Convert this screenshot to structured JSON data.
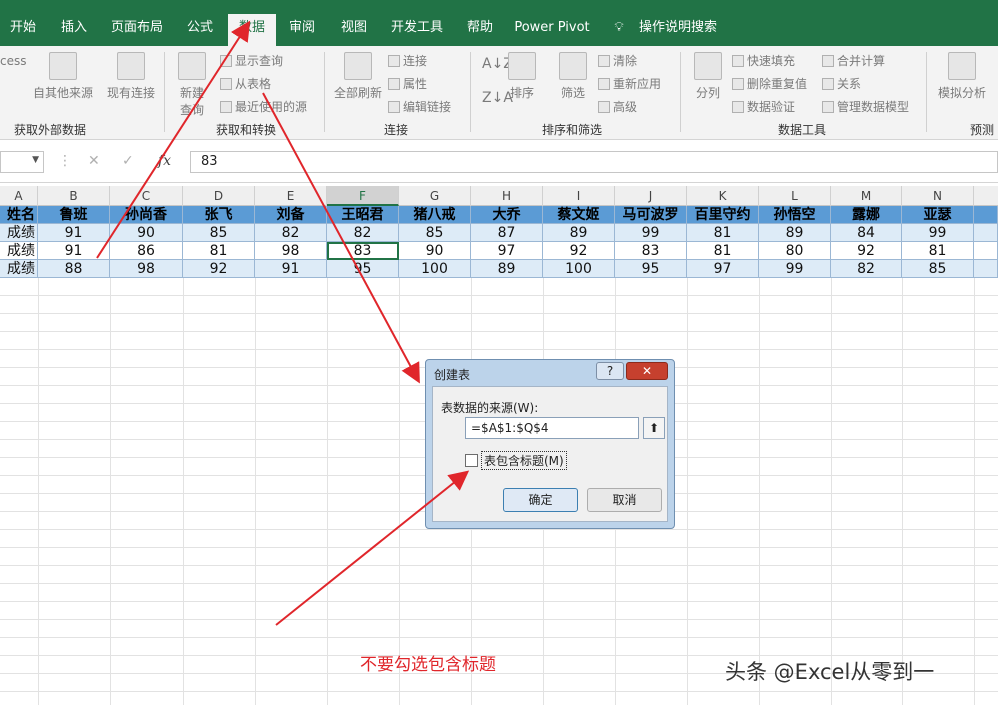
{
  "tabs": [
    {
      "label": "开始"
    },
    {
      "label": "插入"
    },
    {
      "label": "页面布局"
    },
    {
      "label": "公式"
    },
    {
      "label": "数据",
      "active": true
    },
    {
      "label": "审阅"
    },
    {
      "label": "视图"
    },
    {
      "label": "开发工具"
    },
    {
      "label": "帮助"
    },
    {
      "label": "Power Pivot"
    },
    {
      "label": "操作说明搜索"
    }
  ],
  "ribbon": {
    "access_partial": "cess",
    "from_other": "自其他来源",
    "existing": "现有连接",
    "new_query_line1": "新建",
    "new_query_line2": "查询",
    "show_query": "显示查询",
    "from_table": "从表格",
    "recent_sources": "最近使用的源",
    "refresh_all": "全部刷新",
    "connections": "连接",
    "properties": "属性",
    "edit_links": "编辑链接",
    "sort": "排序",
    "filter": "筛选",
    "clear": "清除",
    "reapply": "重新应用",
    "advanced": "高级",
    "text_to_columns": "分列",
    "flash_fill": "快速填充",
    "remove_dup": "删除重复值",
    "validation": "数据验证",
    "consolidate": "合并计算",
    "relationships": "关系",
    "data_model": "管理数据模型",
    "what_if": "模拟分析",
    "groups": {
      "external": "获取外部数据",
      "transform": "获取和转换",
      "conn": "连接",
      "sort_filter": "排序和筛选",
      "tools": "数据工具",
      "forecast": "预测"
    }
  },
  "formula_bar": {
    "fx": "fx",
    "value": "83"
  },
  "columns": [
    "A",
    "B",
    "C",
    "D",
    "E",
    "F",
    "G",
    "H",
    "I",
    "J",
    "K",
    "L",
    "M",
    "N"
  ],
  "selected_column": "F",
  "rows": [
    [
      "姓名",
      "鲁班",
      "孙尚香",
      "张飞",
      "刘备",
      "王昭君",
      "猪八戒",
      "大乔",
      "蔡文姬",
      "马可波罗",
      "百里守约",
      "孙悟空",
      "露娜",
      "亚瑟"
    ],
    [
      "成绩",
      "91",
      "90",
      "85",
      "82",
      "82",
      "85",
      "87",
      "89",
      "99",
      "81",
      "89",
      "84",
      "99"
    ],
    [
      "成绩",
      "91",
      "86",
      "81",
      "98",
      "83",
      "90",
      "97",
      "92",
      "83",
      "81",
      "80",
      "92",
      "81"
    ],
    [
      "成绩",
      "88",
      "98",
      "92",
      "91",
      "95",
      "100",
      "89",
      "100",
      "95",
      "97",
      "99",
      "82",
      "85"
    ]
  ],
  "dialog": {
    "title": "创建表",
    "help": "?",
    "close": "✕",
    "label": "表数据的来源(W):",
    "range": "=$A$1:$Q$4",
    "range_btn": "⬆",
    "checkbox_label": "表包含标题(M)",
    "checkbox_checked": false,
    "ok": "确定",
    "cancel": "取消"
  },
  "annotation": "不要勾选包含标题",
  "watermark": "头条 @Excel从零到一",
  "colors": {
    "accent": "#217346",
    "arrow": "#e0262b",
    "header_band": "#5b9bd5",
    "band_light": "#ddebf7"
  }
}
